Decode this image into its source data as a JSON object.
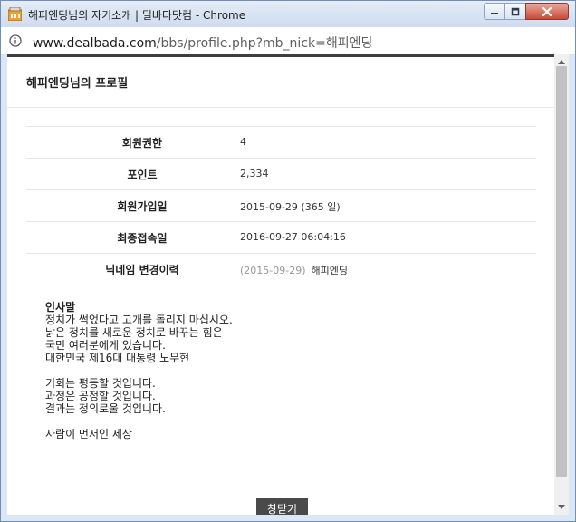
{
  "window": {
    "title": "해피엔딩님의 자기소개 | 딜바다닷컴 - Chrome"
  },
  "address": {
    "host": "www.dealbada.com",
    "path": "/bbs/profile.php?mb_nick=해피엔딩"
  },
  "profile": {
    "title": "해피엔딩님의 프로필",
    "rows": [
      {
        "label": "회원권한",
        "value": "4"
      },
      {
        "label": "포인트",
        "value": "2,334"
      },
      {
        "label": "회원가입일",
        "value": "2015-09-29 (365 일)"
      },
      {
        "label": "최종접속일",
        "value": "2016-09-27 06:04:16"
      },
      {
        "label": "닉네임 변경이력",
        "date": "(2015-09-29)",
        "value": "해피엔딩"
      }
    ],
    "intro_title": "인사말",
    "intro_text": "정치가 썩었다고 고개를 돌리지 마십시오.\n낡은 정치를 새로운 정치로 바꾸는 힘은\n국민 여러분에게 있습니다.\n대한민국 제16대 대통령 노무현\n\n기회는 평등할 것입니다.\n과정은 공정할 것입니다.\n결과는 정의로울 것입니다.\n\n사람이 먼저인 세상"
  },
  "close_button": "창닫기",
  "colors": {
    "accent": "#3e3e3e",
    "button_bg": "#4a4a4a"
  }
}
